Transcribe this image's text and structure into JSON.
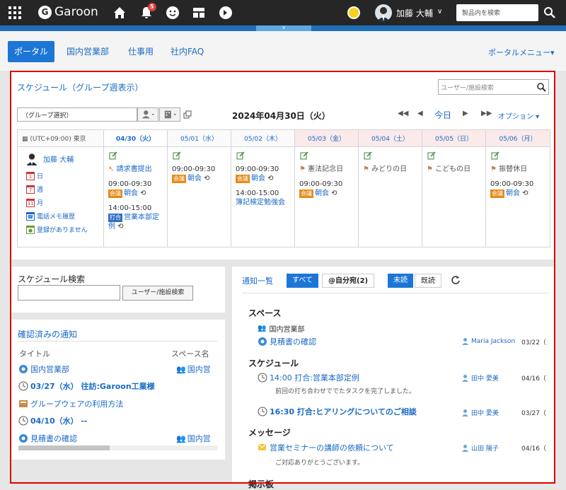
{
  "header": {
    "app_name": "Garoon",
    "notification_count": "5",
    "user_name": "加藤 大輔",
    "search_placeholder": "製品内を検索"
  },
  "nav": {
    "tabs": [
      "ポータル",
      "国内営業部",
      "仕事用",
      "社内FAQ"
    ],
    "portal_menu": "ポータルメニュー▾"
  },
  "schedule": {
    "title": "スケジュール（グループ週表示）",
    "user_search_placeholder": "ユーザー/施設検索",
    "group_select": "（グループ選択）",
    "current_date": "2024年04月30日（火）",
    "today_label": "今日",
    "option_label": "オプション ▾",
    "timezone": "(UTC+09:00) 東京",
    "days": [
      {
        "label": "04/30（火）"
      },
      {
        "label": "05/01（水）"
      },
      {
        "label": "05/02（木）"
      },
      {
        "label": "05/03（金）"
      },
      {
        "label": "05/04（土）"
      },
      {
        "label": "05/05（日）"
      },
      {
        "label": "05/06（月）"
      }
    ],
    "user": {
      "name": "加藤 大輔",
      "links": [
        "日",
        "週",
        "月",
        "電話メモ履歴",
        "登録がありません"
      ]
    },
    "cells": {
      "d0": {
        "flow": "請求書提出",
        "ev1_time": "09:00-09:30",
        "ev1_tag": "会議",
        "ev1_title": "朝会",
        "ev2_time": "14:00-15:00",
        "ev2_tag": "打合",
        "ev2_title": "営業本部定例"
      },
      "d1": {
        "ev1_time": "09:00-09:30",
        "ev1_tag": "会議",
        "ev1_title": "朝会"
      },
      "d2": {
        "ev1_time": "09:00-09:30",
        "ev1_tag": "会議",
        "ev1_title": "朝会",
        "ev2_time": "14:00-15:00",
        "ev2_title": "簿記検定勉強会"
      },
      "d3": {
        "holiday": "憲法記念日",
        "ev1_time": "09:00-09:30",
        "ev1_tag": "会議",
        "ev1_title": "朝会"
      },
      "d4": {
        "holiday": "みどりの日"
      },
      "d5": {
        "holiday": "こどもの日"
      },
      "d6": {
        "holiday": "振替休日",
        "ev1_time": "09:00-09:30",
        "ev1_tag": "会議",
        "ev1_title": "朝会"
      }
    }
  },
  "schedule_search": {
    "title": "スケジュール検索",
    "button": "ユーザー/施設検索"
  },
  "confirmed": {
    "title": "確認済みの通知",
    "col_title": "タイトル",
    "col_space": "スペース名",
    "rows": [
      {
        "title": "国内営業部",
        "space": "国内営"
      },
      {
        "title": "03/27（水） 往訪:Garoon工業様"
      },
      {
        "title": "グループウェアの利用方法"
      },
      {
        "title": "04/10（水） --"
      },
      {
        "title": "見積書の確認",
        "space": "国内営"
      }
    ]
  },
  "notifications": {
    "title": "通知一覧",
    "btn_all": "すべて",
    "btn_mine": "@自分宛(2)",
    "btn_unread": "未読",
    "btn_read": "既読",
    "groups": {
      "space": {
        "heading": "スペース",
        "space_name": "国内営業部",
        "item": "見積書の確認",
        "who": "Maria Jackson",
        "when": "03/22（"
      },
      "schedule": {
        "heading": "スケジュール",
        "item1": "14:00 打合:営業本部定例",
        "sub1": "前回の打ち合わせででたタスクを完了しました。",
        "who1": "田中 愛美",
        "when1": "04/16（",
        "item2": "16:30 打合:ヒアリングについてのご相談",
        "who2": "田中 愛美",
        "when2": "03/27（"
      },
      "message": {
        "heading": "メッセージ",
        "item": "営業セミナーの講師の依頼について",
        "sub": "ご対応ありがとうございます。",
        "who": "山田 陽子",
        "when": "04/16（"
      },
      "board": {
        "heading": "掲示板"
      }
    }
  }
}
